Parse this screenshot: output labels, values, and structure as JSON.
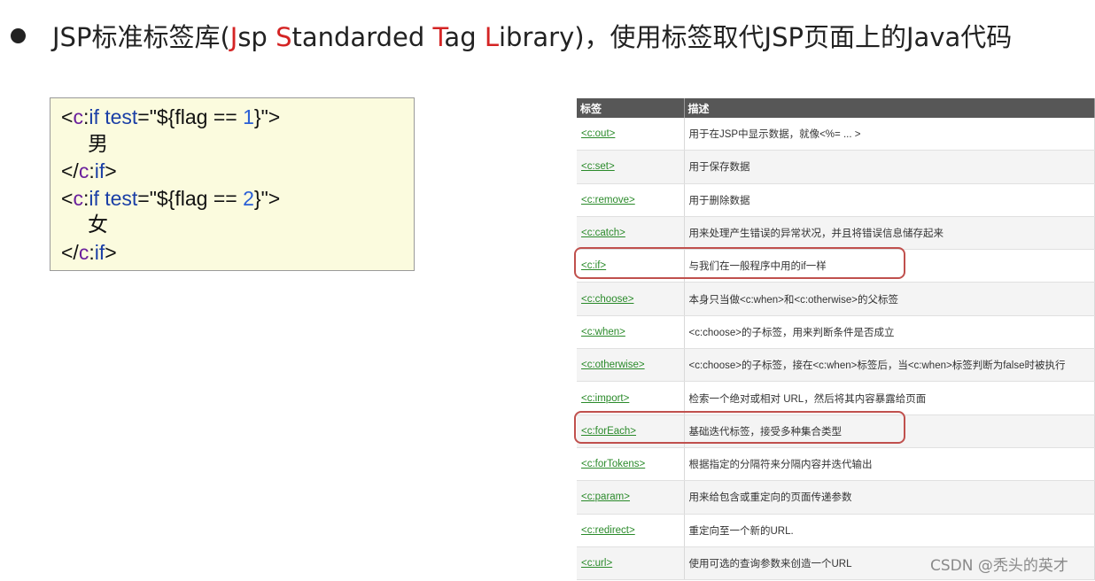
{
  "heading": {
    "prefix": "JSP标准标签库(",
    "j": "J",
    "jrest": "sp ",
    "s": "S",
    "srest": "tandarded ",
    "t": "T",
    "trest": "ag ",
    "l": "L",
    "lrest": "ibrary)，使用标签取代JSP页面上的Java代码"
  },
  "code": {
    "line1": {
      "open": "<",
      "ns": "c",
      "colon": ":",
      "tag": "if",
      "sp": " ",
      "attr": "test",
      "eq": "=\"${",
      "expr": "flag == ",
      "num": "1",
      "close": "}\">"
    },
    "line2": "男",
    "line3": {
      "open": "</",
      "ns": "c",
      "colon": ":",
      "tag": "if",
      "close": ">"
    },
    "line4": {
      "open": "<",
      "ns": "c",
      "colon": ":",
      "tag": "if",
      "sp": " ",
      "attr": "test",
      "eq": "=\"${",
      "expr": "flag == ",
      "num": "2",
      "close": "}\">"
    },
    "line5": "女",
    "line6": {
      "open": "</",
      "ns": "c",
      "colon": ":",
      "tag": "if",
      "close": ">"
    }
  },
  "table": {
    "headers": [
      "标签",
      "描述"
    ],
    "rows": [
      {
        "tag": "<c:out>",
        "desc": "用于在JSP中显示数据，就像<%= ... >"
      },
      {
        "tag": "<c:set>",
        "desc": "用于保存数据"
      },
      {
        "tag": "<c:remove>",
        "desc": "用于删除数据"
      },
      {
        "tag": "<c:catch>",
        "desc": "用来处理产生错误的异常状况，并且将错误信息储存起来"
      },
      {
        "tag": "<c:if>",
        "desc": "与我们在一般程序中用的if一样"
      },
      {
        "tag": "<c:choose>",
        "desc": "本身只当做<c:when>和<c:otherwise>的父标签"
      },
      {
        "tag": "<c:when>",
        "desc": "<c:choose>的子标签，用来判断条件是否成立"
      },
      {
        "tag": "<c:otherwise>",
        "desc": "<c:choose>的子标签，接在<c:when>标签后，当<c:when>标签判断为false时被执行"
      },
      {
        "tag": "<c:import>",
        "desc": "检索一个绝对或相对 URL，然后将其内容暴露给页面"
      },
      {
        "tag": "<c:forEach>",
        "desc": "基础迭代标签，接受多种集合类型"
      },
      {
        "tag": "<c:forTokens>",
        "desc": "根据指定的分隔符来分隔内容并迭代输出"
      },
      {
        "tag": "<c:param>",
        "desc": "用来给包含或重定向的页面传递参数"
      },
      {
        "tag": "<c:redirect>",
        "desc": "重定向至一个新的URL."
      },
      {
        "tag": "<c:url>",
        "desc": "使用可选的查询参数来创造一个URL"
      }
    ]
  },
  "watermark": "CSDN @秃头的英才",
  "colors": {
    "highlight": "#c0504d",
    "header_bg": "#575757",
    "code_bg": "#fbfbde",
    "link": "#2a8a2a",
    "accent_red": "#d42424"
  }
}
